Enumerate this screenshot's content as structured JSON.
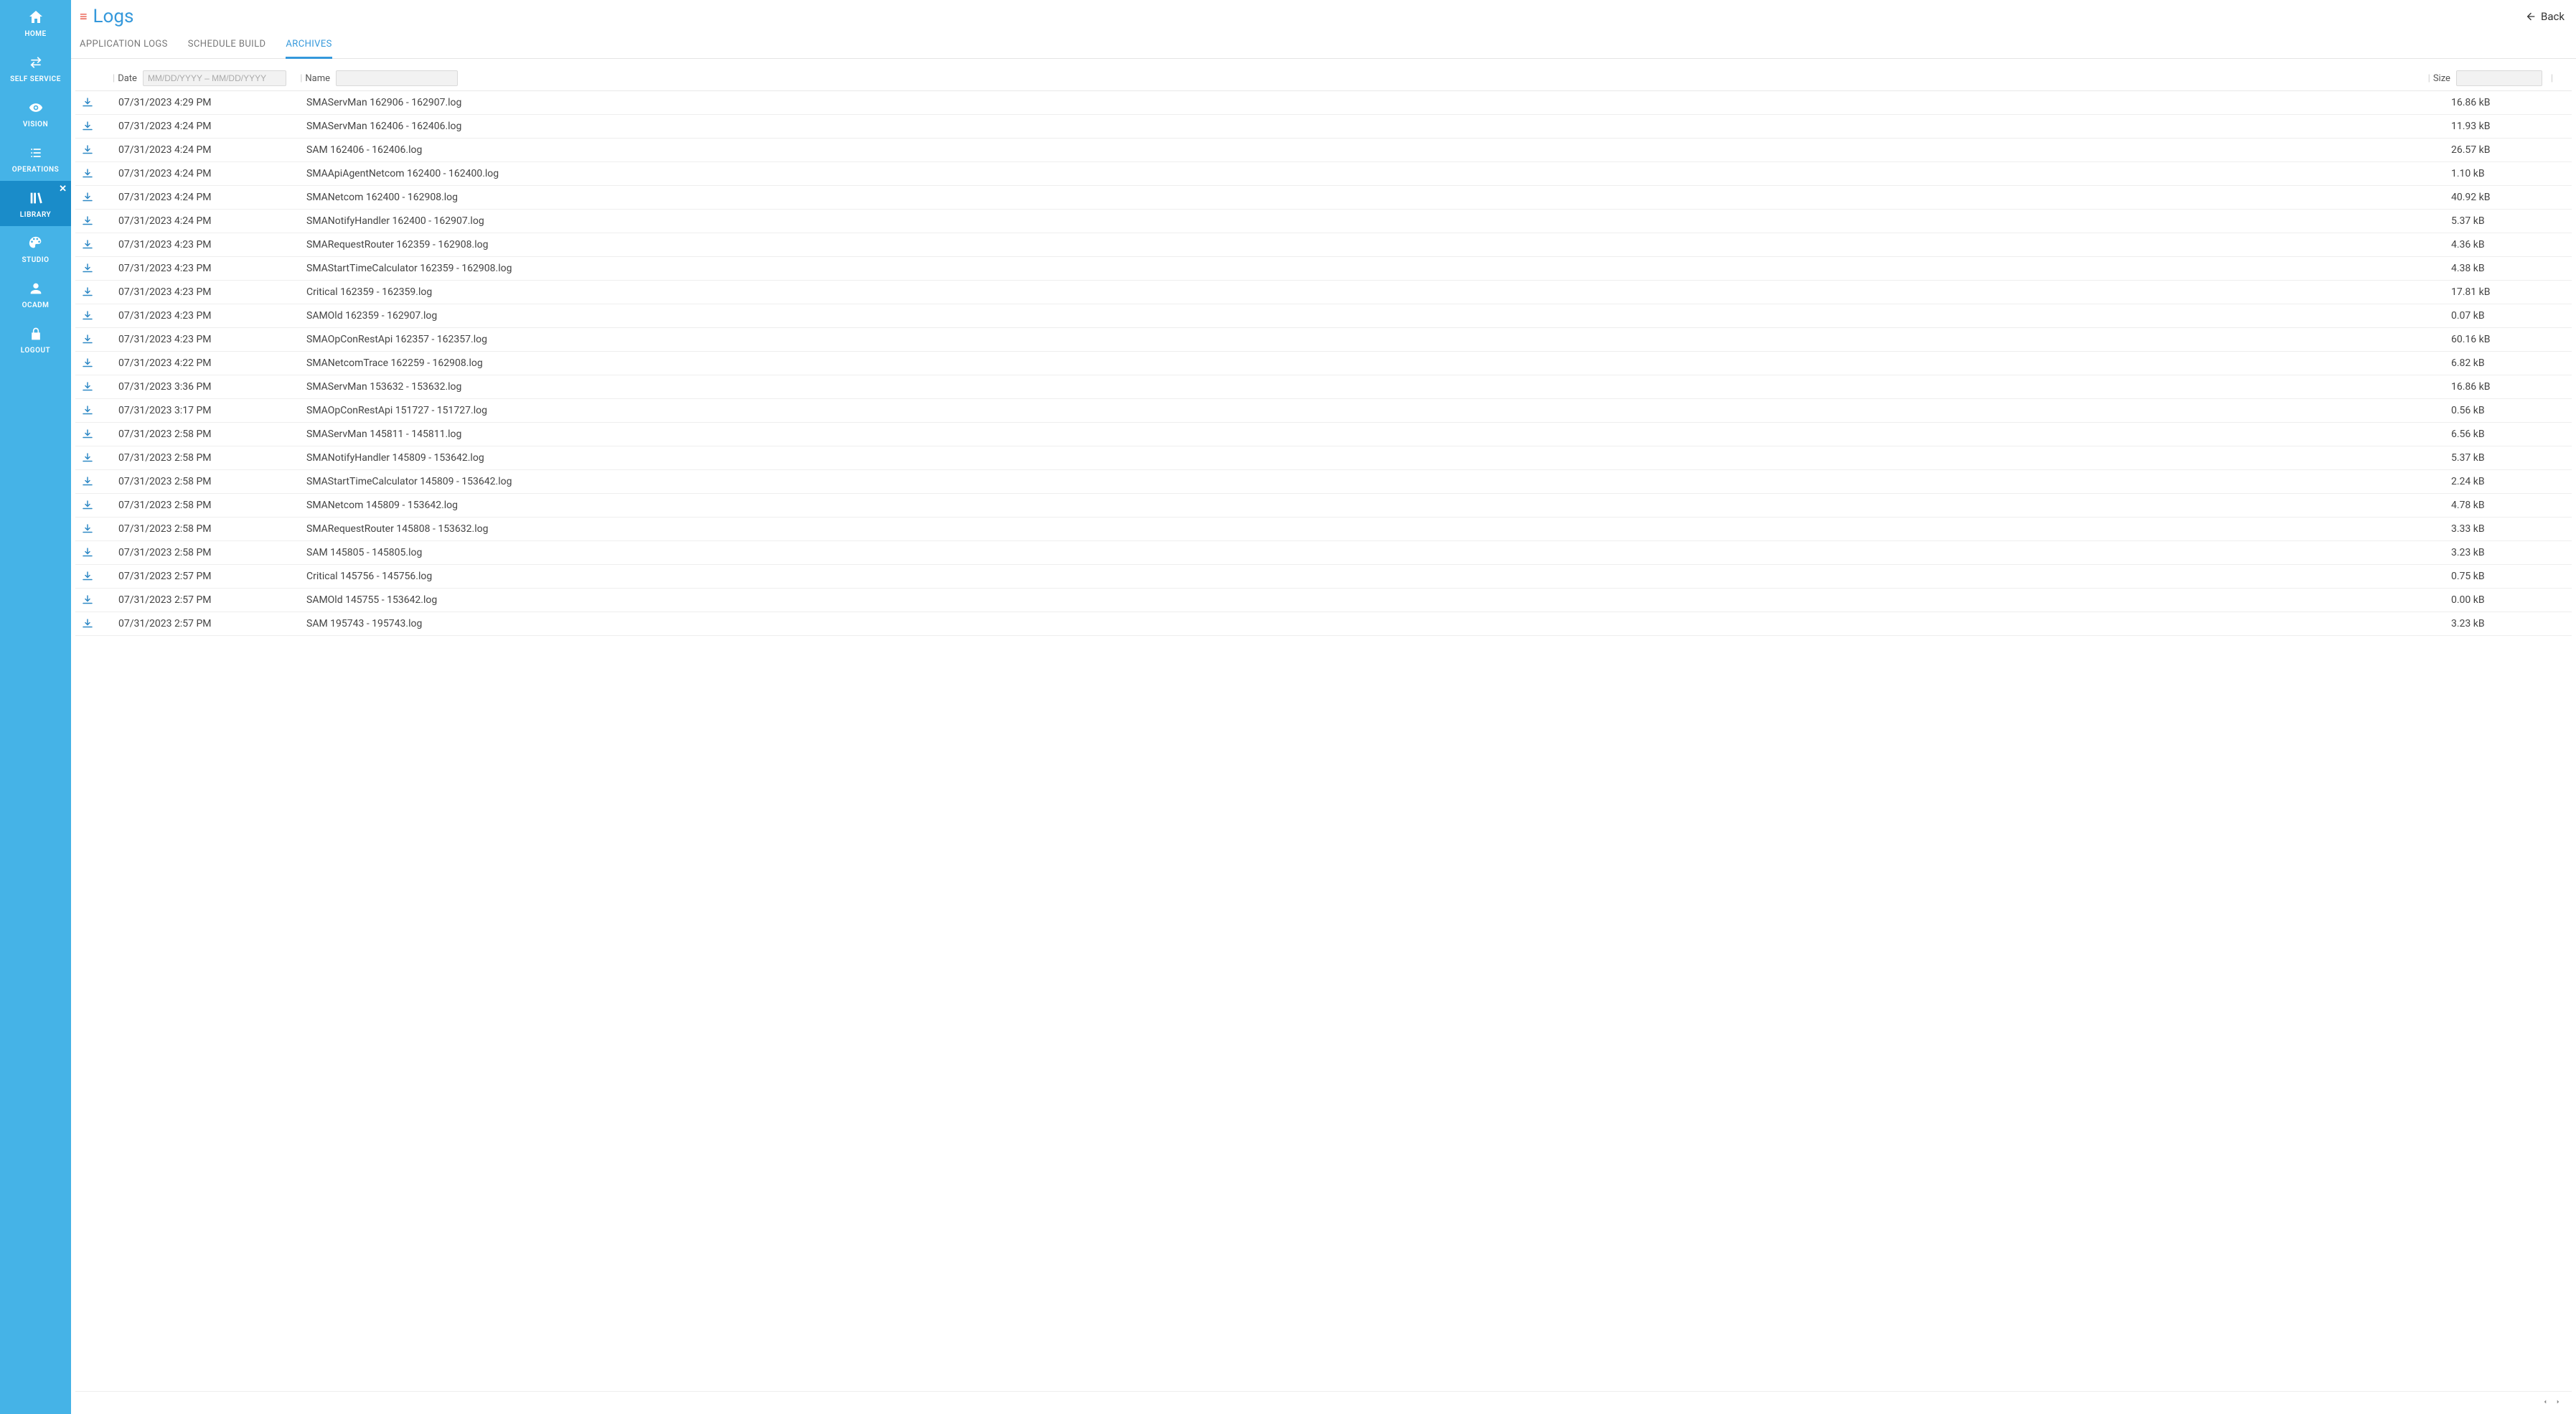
{
  "sidebar": {
    "items": [
      {
        "label": "HOME"
      },
      {
        "label": "SELF SERVICE"
      },
      {
        "label": "VISION"
      },
      {
        "label": "OPERATIONS"
      },
      {
        "label": "LIBRARY"
      },
      {
        "label": "STUDIO"
      },
      {
        "label": "OCADM"
      },
      {
        "label": "LOGOUT"
      }
    ],
    "active_index": 4
  },
  "header": {
    "title": "Logs",
    "back_label": "Back"
  },
  "tabs": [
    {
      "label": "APPLICATION LOGS"
    },
    {
      "label": "SCHEDULE BUILD"
    },
    {
      "label": "ARCHIVES"
    }
  ],
  "active_tab_index": 2,
  "columns": {
    "date_label": "Date",
    "date_placeholder": "MM/DD/YYYY – MM/DD/YYYY",
    "name_label": "Name",
    "size_label": "Size"
  },
  "rows": [
    {
      "date": "07/31/2023 4:29 PM",
      "name": "SMAServMan 162906 - 162907.log",
      "size": "16.86 kB"
    },
    {
      "date": "07/31/2023 4:24 PM",
      "name": "SMAServMan 162406 - 162406.log",
      "size": "11.93 kB"
    },
    {
      "date": "07/31/2023 4:24 PM",
      "name": "SAM 162406 - 162406.log",
      "size": "26.57 kB"
    },
    {
      "date": "07/31/2023 4:24 PM",
      "name": "SMAApiAgentNetcom 162400 - 162400.log",
      "size": "1.10 kB"
    },
    {
      "date": "07/31/2023 4:24 PM",
      "name": "SMANetcom 162400 - 162908.log",
      "size": "40.92 kB"
    },
    {
      "date": "07/31/2023 4:24 PM",
      "name": "SMANotifyHandler 162400 - 162907.log",
      "size": "5.37 kB"
    },
    {
      "date": "07/31/2023 4:23 PM",
      "name": "SMARequestRouter 162359 - 162908.log",
      "size": "4.36 kB"
    },
    {
      "date": "07/31/2023 4:23 PM",
      "name": "SMAStartTimeCalculator 162359 - 162908.log",
      "size": "4.38 kB"
    },
    {
      "date": "07/31/2023 4:23 PM",
      "name": "Critical 162359 - 162359.log",
      "size": "17.81 kB"
    },
    {
      "date": "07/31/2023 4:23 PM",
      "name": "SAMOld 162359 - 162907.log",
      "size": "0.07 kB"
    },
    {
      "date": "07/31/2023 4:23 PM",
      "name": "SMAOpConRestApi 162357 - 162357.log",
      "size": "60.16 kB"
    },
    {
      "date": "07/31/2023 4:22 PM",
      "name": "SMANetcomTrace 162259 - 162908.log",
      "size": "6.82 kB"
    },
    {
      "date": "07/31/2023 3:36 PM",
      "name": "SMAServMan 153632 - 153632.log",
      "size": "16.86 kB"
    },
    {
      "date": "07/31/2023 3:17 PM",
      "name": "SMAOpConRestApi 151727 - 151727.log",
      "size": "0.56 kB"
    },
    {
      "date": "07/31/2023 2:58 PM",
      "name": "SMAServMan 145811 - 145811.log",
      "size": "6.56 kB"
    },
    {
      "date": "07/31/2023 2:58 PM",
      "name": "SMANotifyHandler 145809 - 153642.log",
      "size": "5.37 kB"
    },
    {
      "date": "07/31/2023 2:58 PM",
      "name": "SMAStartTimeCalculator 145809 - 153642.log",
      "size": "2.24 kB"
    },
    {
      "date": "07/31/2023 2:58 PM",
      "name": "SMANetcom 145809 - 153642.log",
      "size": "4.78 kB"
    },
    {
      "date": "07/31/2023 2:58 PM",
      "name": "SMARequestRouter 145808 - 153632.log",
      "size": "3.33 kB"
    },
    {
      "date": "07/31/2023 2:58 PM",
      "name": "SAM 145805 - 145805.log",
      "size": "3.23 kB"
    },
    {
      "date": "07/31/2023 2:57 PM",
      "name": "Critical 145756 - 145756.log",
      "size": "0.75 kB"
    },
    {
      "date": "07/31/2023 2:57 PM",
      "name": "SAMOld 145755 - 153642.log",
      "size": "0.00 kB"
    },
    {
      "date": "07/31/2023 2:57 PM",
      "name": "SAM 195743 - 195743.log",
      "size": "3.23 kB"
    }
  ]
}
